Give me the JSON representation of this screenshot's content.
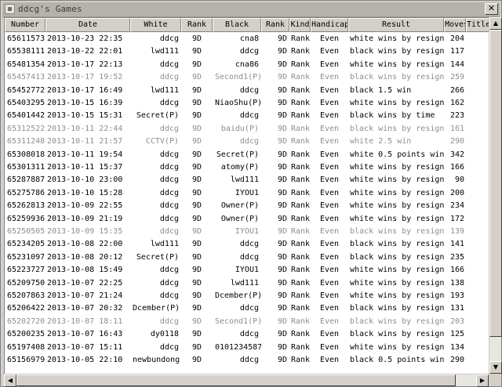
{
  "window": {
    "title": "ddcg's Games"
  },
  "columns": [
    "Number",
    "Date",
    "White",
    "Rank",
    "Black",
    "Rank",
    "Kind",
    "Handicap",
    "Result",
    "Moves",
    "Title"
  ],
  "games": [
    {
      "number": "65611573",
      "date": "2013-10-23 22:35",
      "white": "ddcg",
      "wrank": "9D",
      "black": "cna8",
      "brank": "9D",
      "kind": "Rank",
      "handicap": "Even",
      "result": "white wins by resignat",
      "moves": "204",
      "dim": false
    },
    {
      "number": "65538111",
      "date": "2013-10-22 22:01",
      "white": "lwd111",
      "wrank": "9D",
      "black": "ddcg",
      "brank": "9D",
      "kind": "Rank",
      "handicap": "Even",
      "result": "black wins by resignat",
      "moves": "117",
      "dim": false
    },
    {
      "number": "65481354",
      "date": "2013-10-17 22:13",
      "white": "ddcg",
      "wrank": "9D",
      "black": "cna86",
      "brank": "9D",
      "kind": "Rank",
      "handicap": "Even",
      "result": "white wins by resignat",
      "moves": "144",
      "dim": false
    },
    {
      "number": "65457413",
      "date": "2013-10-17 19:52",
      "white": "ddcg",
      "wrank": "9D",
      "black": "Second1(P)",
      "brank": "9D",
      "kind": "Rank",
      "handicap": "Even",
      "result": "black wins by resignat",
      "moves": "259",
      "dim": true
    },
    {
      "number": "65452772",
      "date": "2013-10-17 16:49",
      "white": "lwd111",
      "wrank": "9D",
      "black": "ddcg",
      "brank": "9D",
      "kind": "Rank",
      "handicap": "Even",
      "result": "black 1.5 win",
      "moves": "266",
      "dim": false
    },
    {
      "number": "65403295",
      "date": "2013-10-15 16:39",
      "white": "ddcg",
      "wrank": "9D",
      "black": "NiaoShu(P)",
      "brank": "9D",
      "kind": "Rank",
      "handicap": "Even",
      "result": "white wins by resignat",
      "moves": "162",
      "dim": false
    },
    {
      "number": "65401442",
      "date": "2013-10-15 15:31",
      "white": "Secret(P)",
      "wrank": "9D",
      "black": "ddcg",
      "brank": "9D",
      "kind": "Rank",
      "handicap": "Even",
      "result": "black wins by time",
      "moves": "223",
      "dim": false
    },
    {
      "number": "65312522",
      "date": "2013-10-11 22:44",
      "white": "ddcg",
      "wrank": "9D",
      "black": "baidu(P)",
      "brank": "9D",
      "kind": "Rank",
      "handicap": "Even",
      "result": "black wins by resignat",
      "moves": "161",
      "dim": true
    },
    {
      "number": "65311248",
      "date": "2013-10-11 21:57",
      "white": "CCTV(P)",
      "wrank": "9D",
      "black": "ddcg",
      "brank": "9D",
      "kind": "Rank",
      "handicap": "Even",
      "result": "white 2.5 win",
      "moves": "290",
      "dim": true
    },
    {
      "number": "65308018",
      "date": "2013-10-11 19:54",
      "white": "ddcg",
      "wrank": "9D",
      "black": "Secret(P)",
      "brank": "9D",
      "kind": "Rank",
      "handicap": "Even",
      "result": "white 0.5 points win",
      "moves": "342",
      "dim": false
    },
    {
      "number": "65301311",
      "date": "2013-10-11 15:37",
      "white": "ddcg",
      "wrank": "9D",
      "black": "atomy(P)",
      "brank": "9D",
      "kind": "Rank",
      "handicap": "Even",
      "result": "white wins by resignat",
      "moves": "166",
      "dim": false
    },
    {
      "number": "65287887",
      "date": "2013-10-10 23:00",
      "white": "ddcg",
      "wrank": "9D",
      "black": "lwd111",
      "brank": "9D",
      "kind": "Rank",
      "handicap": "Even",
      "result": "white wins by resignat",
      "moves": "90",
      "dim": false
    },
    {
      "number": "65275786",
      "date": "2013-10-10 15:28",
      "white": "ddcg",
      "wrank": "9D",
      "black": "IYOU1",
      "brank": "9D",
      "kind": "Rank",
      "handicap": "Even",
      "result": "white wins by resignat",
      "moves": "200",
      "dim": false
    },
    {
      "number": "65262813",
      "date": "2013-10-09 22:55",
      "white": "ddcg",
      "wrank": "9D",
      "black": "Owner(P)",
      "brank": "9D",
      "kind": "Rank",
      "handicap": "Even",
      "result": "white wins by resignat",
      "moves": "234",
      "dim": false
    },
    {
      "number": "65259936",
      "date": "2013-10-09 21:19",
      "white": "ddcg",
      "wrank": "9D",
      "black": "Owner(P)",
      "brank": "9D",
      "kind": "Rank",
      "handicap": "Even",
      "result": "white wins by resignat",
      "moves": "172",
      "dim": false
    },
    {
      "number": "65250505",
      "date": "2013-10-09 15:35",
      "white": "ddcg",
      "wrank": "9D",
      "black": "IYOU1",
      "brank": "9D",
      "kind": "Rank",
      "handicap": "Even",
      "result": "black wins by resignat",
      "moves": "139",
      "dim": true
    },
    {
      "number": "65234205",
      "date": "2013-10-08 22:00",
      "white": "lwd111",
      "wrank": "9D",
      "black": "ddcg",
      "brank": "9D",
      "kind": "Rank",
      "handicap": "Even",
      "result": "black wins by resignat",
      "moves": "141",
      "dim": false
    },
    {
      "number": "65231097",
      "date": "2013-10-08 20:12",
      "white": "Secret(P)",
      "wrank": "9D",
      "black": "ddcg",
      "brank": "9D",
      "kind": "Rank",
      "handicap": "Even",
      "result": "black wins by resignat",
      "moves": "235",
      "dim": false
    },
    {
      "number": "65223727",
      "date": "2013-10-08 15:49",
      "white": "ddcg",
      "wrank": "9D",
      "black": "IYOU1",
      "brank": "9D",
      "kind": "Rank",
      "handicap": "Even",
      "result": "white wins by resignat",
      "moves": "166",
      "dim": false
    },
    {
      "number": "65209750",
      "date": "2013-10-07 22:25",
      "white": "ddcg",
      "wrank": "9D",
      "black": "lwd111",
      "brank": "9D",
      "kind": "Rank",
      "handicap": "Even",
      "result": "white wins by resignat",
      "moves": "138",
      "dim": false
    },
    {
      "number": "65207863",
      "date": "2013-10-07 21:24",
      "white": "ddcg",
      "wrank": "9D",
      "black": "Dcember(P)",
      "brank": "9D",
      "kind": "Rank",
      "handicap": "Even",
      "result": "white wins by resignat",
      "moves": "193",
      "dim": false
    },
    {
      "number": "65206422",
      "date": "2013-10-07 20:32",
      "white": "Dcember(P)",
      "wrank": "9D",
      "black": "ddcg",
      "brank": "9D",
      "kind": "Rank",
      "handicap": "Even",
      "result": "black wins by resignat",
      "moves": "131",
      "dim": false
    },
    {
      "number": "65202720",
      "date": "2013-10-07 18:11",
      "white": "ddcg",
      "wrank": "9D",
      "black": "Second1(P)",
      "brank": "9D",
      "kind": "Rank",
      "handicap": "Even",
      "result": "black wins by resignat",
      "moves": "203",
      "dim": true
    },
    {
      "number": "65200235",
      "date": "2013-10-07 16:43",
      "white": "dy0118",
      "wrank": "9D",
      "black": "ddcg",
      "brank": "9D",
      "kind": "Rank",
      "handicap": "Even",
      "result": "black wins by resignat",
      "moves": "125",
      "dim": false
    },
    {
      "number": "65197408",
      "date": "2013-10-07 15:11",
      "white": "ddcg",
      "wrank": "9D",
      "black": "0101234587",
      "brank": "9D",
      "kind": "Rank",
      "handicap": "Even",
      "result": "white wins by resignat",
      "moves": "134",
      "dim": false
    },
    {
      "number": "65156979",
      "date": "2013-10-05 22:10",
      "white": "newbundong",
      "wrank": "9D",
      "black": "ddcg",
      "brank": "9D",
      "kind": "Rank",
      "handicap": "Even",
      "result": "black 0.5 points win",
      "moves": "290",
      "dim": false
    }
  ],
  "scroll": {
    "up": "▲",
    "down": "▼",
    "left": "◀",
    "right": "▶",
    "close": "✕"
  }
}
